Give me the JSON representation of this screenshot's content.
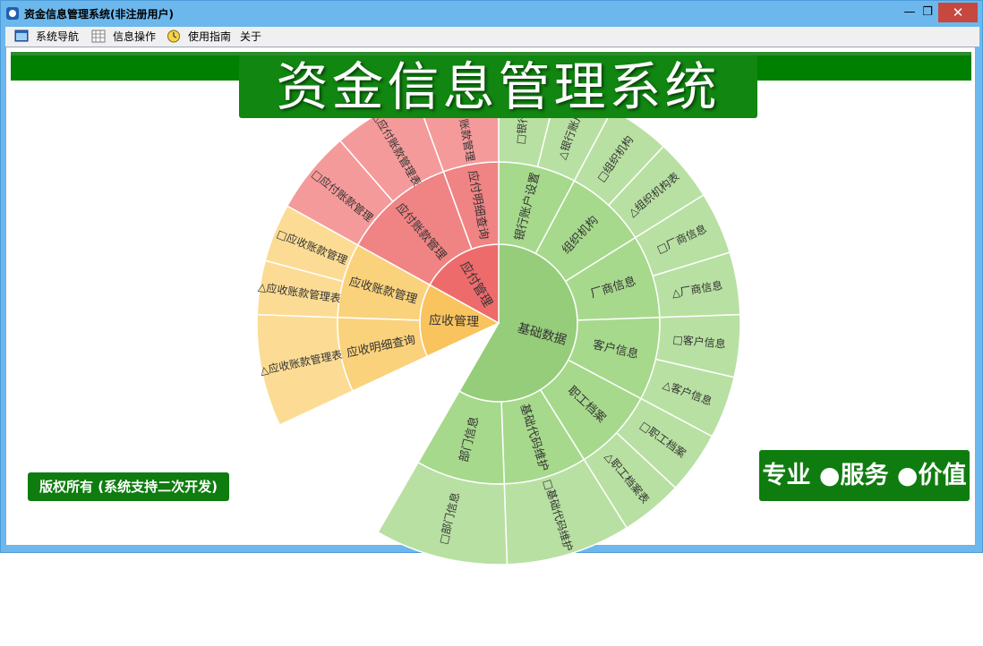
{
  "window": {
    "title": "资金信息管理系统(非注册用户)",
    "controls": {
      "minimize": "—",
      "maximize": "❐",
      "close": "✕"
    }
  },
  "menu": [
    {
      "label": "系统导航",
      "icon": "window-icon"
    },
    {
      "label": "信息操作",
      "icon": "grid-icon"
    },
    {
      "label": "使用指南",
      "icon": "clock-icon"
    },
    {
      "label": "关于",
      "icon": ""
    }
  ],
  "header": {
    "title": "资金信息管理系统"
  },
  "footer": {
    "copyright": "版权所有 (系统支持二次开发)",
    "slogan": "专业 ●服务 ●价值"
  },
  "colors": {
    "green_l1": "#95cd7a",
    "green_l2": "#a6d98c",
    "green_l3": "#b8e0a2",
    "red_l1": "#ee6b6b",
    "red_l2": "#f08383",
    "red_l3": "#f59a9a",
    "yellow_l1": "#f9c35e",
    "yellow_l2": "#fad27c",
    "yellow_l3": "#fcdc94",
    "header_green": "#118611",
    "band_green": "#008000"
  },
  "chart_data": {
    "type": "sunburst",
    "rings": 3,
    "nodes": [
      {
        "name": "基础数据",
        "color": "green",
        "children": [
          {
            "name": "银行账户设置",
            "children": [
              {
                "name": "□银行账"
              },
              {
                "name": "△银行账户"
              }
            ]
          },
          {
            "name": "组织机构",
            "children": [
              {
                "name": "□组织机构"
              },
              {
                "name": "△组织机构表"
              }
            ]
          },
          {
            "name": "厂商信息",
            "children": [
              {
                "name": "□厂商信息"
              },
              {
                "name": "△厂商信息"
              }
            ]
          },
          {
            "name": "客户信息",
            "children": [
              {
                "name": "□客户信息"
              },
              {
                "name": "△客户信息"
              }
            ]
          },
          {
            "name": "职工档案",
            "children": [
              {
                "name": "□职工档案"
              },
              {
                "name": "△职工档案表"
              }
            ]
          },
          {
            "name": "基础代码维护",
            "children": [
              {
                "name": "□基础代码维护"
              }
            ]
          },
          {
            "name": "部门信息",
            "children": [
              {
                "name": "□部门信息"
              }
            ]
          }
        ]
      },
      {
        "name": "应收管理",
        "color": "yellow",
        "children": [
          {
            "name": "应收明细查询",
            "children": [
              {
                "name": "△应收账款管理表"
              }
            ]
          },
          {
            "name": "应收账款管理",
            "children": [
              {
                "name": "△应收账款管理表"
              },
              {
                "name": "□应收账款管理"
              }
            ]
          }
        ]
      },
      {
        "name": "应付管理",
        "color": "red",
        "children": [
          {
            "name": "应付账款管理",
            "children": [
              {
                "name": "□应付账款管理"
              },
              {
                "name": "△应付账款管理表"
              }
            ]
          },
          {
            "name": "应付明细查询",
            "children": [
              {
                "name": "□应付账款管理"
              }
            ]
          }
        ]
      }
    ]
  }
}
